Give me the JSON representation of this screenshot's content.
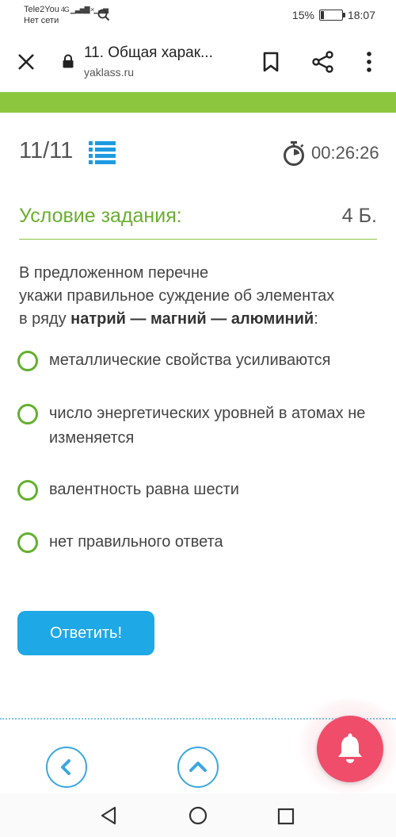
{
  "status_bar": {
    "carrier": "Tele2You",
    "network_status": "Нет сети",
    "signal_label": "4G",
    "battery_percent": 15,
    "battery_text": "15%",
    "time": "18:07"
  },
  "browser": {
    "page_title": "11. Общая харак...",
    "url": "yaklass.ru"
  },
  "task_header": {
    "counter": "11/11",
    "timer": "00:26:26"
  },
  "condition": {
    "title": "Условие задания:",
    "points": "4 Б."
  },
  "question": {
    "line1": "В предложенном перечне",
    "line2": "укажи правильное суждение об элементах",
    "line3_prefix": "в ряду ",
    "line3_bold": "натрий — магний — алюминий",
    "line3_suffix": ":"
  },
  "options": [
    {
      "text": "металлические свойства усиливаются"
    },
    {
      "text": "число энергетических уровней в атомах не изменяется"
    },
    {
      "text": "валентность равна шести"
    },
    {
      "text": "нет правильного ответа"
    }
  ],
  "answer_button": {
    "label": "Ответить!"
  },
  "colors": {
    "accent_green": "#8cc63f",
    "radio_green": "#62b02f",
    "button_blue": "#1ea8e6",
    "bell_red": "#f04d6b"
  },
  "icons": {
    "close": "close-icon",
    "lock": "lock-icon",
    "bookmark": "bookmark-icon",
    "share": "share-icon",
    "menu": "more-vertical-icon",
    "task_list": "list-icon",
    "timer": "stopwatch-icon",
    "prev": "chevron-left-icon",
    "up": "chevron-up-icon",
    "bell": "bell-icon",
    "nav_back": "triangle-back-icon",
    "nav_home": "circle-home-icon",
    "nav_recent": "square-recent-icon"
  }
}
